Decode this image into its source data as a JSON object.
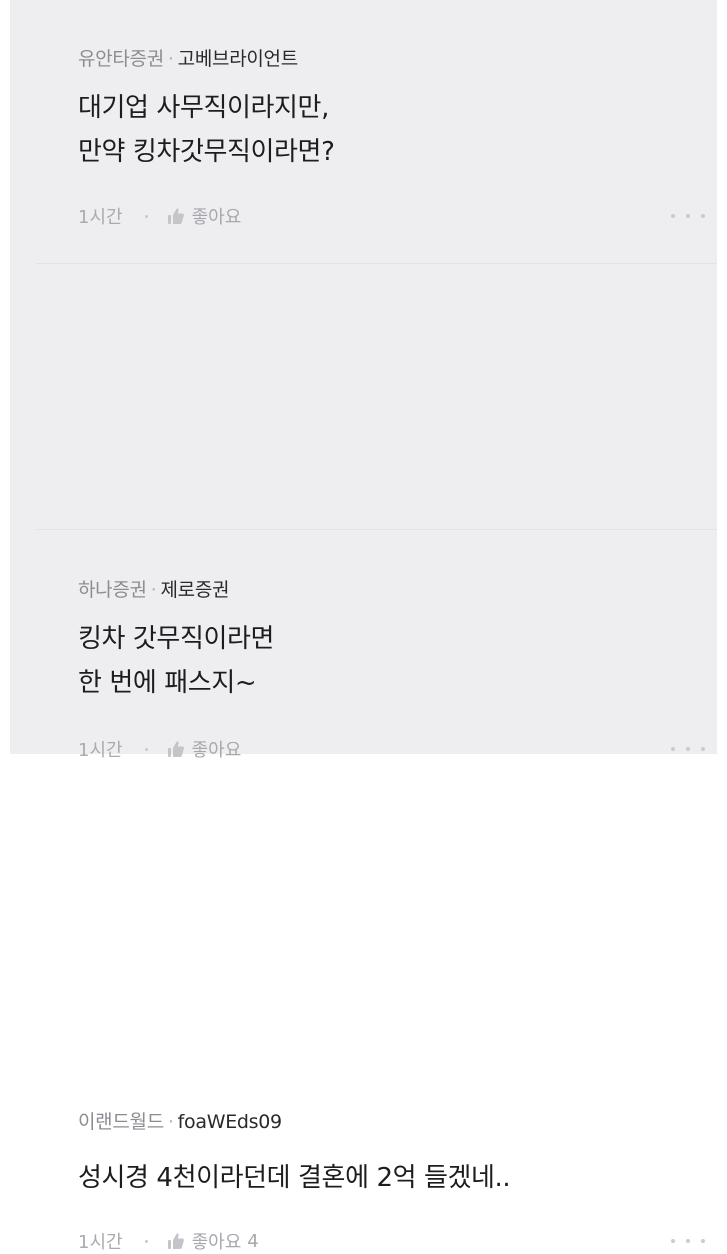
{
  "comments": [
    {
      "company": "유안타증권",
      "separator": "·",
      "nickname": "고베브라이언트",
      "text": "대기업 사무직이라지만,\n만약 킹차갓무직이라면?",
      "time": "1시간",
      "like_label": "좋아요",
      "like_count": ""
    },
    {
      "company": "하나증권",
      "separator": "·",
      "nickname": "제로증권",
      "text": "킹차 갓무직이라면\n한 번에 패스지~",
      "time": "1시간",
      "like_label": "좋아요",
      "like_count": ""
    },
    {
      "company": "이랜드월드",
      "separator": "·",
      "nickname": "foaWEds09",
      "text": "성시경 4천이라던데 결혼에 2억 들겠네..",
      "time": "1시간",
      "like_label": "좋아요",
      "like_count": "4"
    }
  ],
  "icons": {
    "like": "thumbs-up-icon",
    "more": "more-dots-icon"
  },
  "colors": {
    "background": "#eeeef1",
    "text_primary": "#1d1d20",
    "text_meta": "#909096",
    "text_muted": "#aaaab0"
  }
}
